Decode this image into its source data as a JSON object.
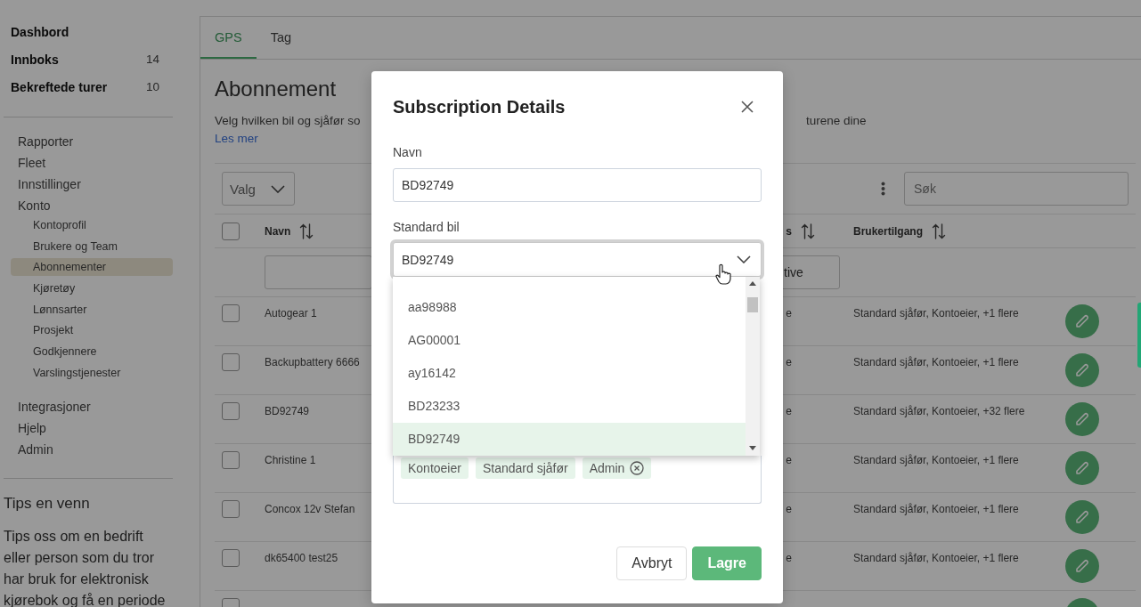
{
  "sidebar": {
    "top_items": [
      {
        "label": "Dashbord"
      },
      {
        "label": "Innboks",
        "count": "14"
      },
      {
        "label": "Bekreftede turer",
        "count": "10"
      }
    ],
    "menu": [
      {
        "label": "Rapporter",
        "selected": false
      },
      {
        "label": "Fleet",
        "selected": false
      },
      {
        "label": "Innstillinger",
        "selected": false
      },
      {
        "label": "Konto",
        "selected": false,
        "children": [
          {
            "label": "Kontoprofil",
            "selected": false
          },
          {
            "label": "Brukere og Team",
            "selected": false
          },
          {
            "label": "Abonnementer",
            "selected": true
          },
          {
            "label": "Kjøretøy",
            "selected": false
          },
          {
            "label": "Lønnsarter",
            "selected": false
          },
          {
            "label": "Prosjekt",
            "selected": false
          },
          {
            "label": "Godkjennere",
            "selected": false
          },
          {
            "label": "Varslingstjenester",
            "selected": false
          }
        ]
      },
      {
        "label": "Integrasjoner",
        "selected": false
      },
      {
        "label": "Hjelp",
        "selected": false
      },
      {
        "label": "Admin",
        "selected": false
      }
    ],
    "tips": {
      "title": "Tips en venn",
      "text": "Tips oss om en bedrift eller person som du tror har bruk for elektronisk kjørebok og få en periode"
    }
  },
  "main": {
    "tabs": [
      {
        "label": "GPS",
        "selected": true
      },
      {
        "label": "Tag",
        "selected": false
      }
    ],
    "title": "Abonnement",
    "description": [
      "Velg hvilken bil og sjåfør so",
      "turene dine"
    ],
    "link": "Les mer"
  },
  "table": {
    "filter_button": "Valg",
    "search": {
      "placeholder": "Søk"
    },
    "all_checked": false,
    "columns": [
      {
        "label": "Navn"
      },
      {
        "label": "s"
      },
      {
        "label": "Brukertilgang"
      }
    ],
    "status_filter": "tive",
    "rows": [
      {
        "checked": false,
        "name": "Autogear 1",
        "column_6": "e",
        "access": "Standard sjåfør, Kontoeier, +1 flere"
      },
      {
        "checked": false,
        "name": "Backupbattery 6666",
        "column_6": "e",
        "access": "Standard sjåfør, Kontoeier, +1 flere"
      },
      {
        "checked": false,
        "name": "BD92749",
        "column_6": "e",
        "access": "Standard sjåfør, Kontoeier, +32 flere"
      },
      {
        "checked": false,
        "name": "Christine 1",
        "column_6": "e",
        "access": "Standard sjåfør, Kontoeier, +1 flere"
      },
      {
        "checked": false,
        "name": "Concox 12v Stefan",
        "column_6": "e",
        "access": "Standard sjåfør, Kontoeier, +1 flere"
      },
      {
        "checked": false,
        "name": "dk65400 test25",
        "column_6": "e",
        "access": "Standard sjåfør, Kontoeier, +1 flere"
      },
      {
        "checked": false
      }
    ]
  },
  "modal": {
    "title": "Subscription Details",
    "fields": [
      {
        "kind": "text",
        "label": "Navn",
        "value": "BD92749"
      },
      {
        "kind": "select",
        "label": "Standard bil",
        "value": "BD92749",
        "focused": true,
        "open": true,
        "options": [
          {
            "label": "aa98988",
            "selected": false
          },
          {
            "label": "AG00001",
            "selected": false
          },
          {
            "label": "ay16142",
            "selected": false
          },
          {
            "label": "BD23233",
            "selected": false
          },
          {
            "label": "BD92749",
            "selected": true
          }
        ]
      },
      {
        "kind": "tags",
        "tags": [
          {
            "label": "Kontoeier",
            "removable": false
          },
          {
            "label": "Standard sjåfør",
            "removable": false
          },
          {
            "label": "Admin",
            "removable": true
          }
        ]
      }
    ],
    "buttons": [
      {
        "kind": "secondary",
        "label": "Avbryt"
      },
      {
        "kind": "primary",
        "label": "Lagre"
      }
    ]
  }
}
